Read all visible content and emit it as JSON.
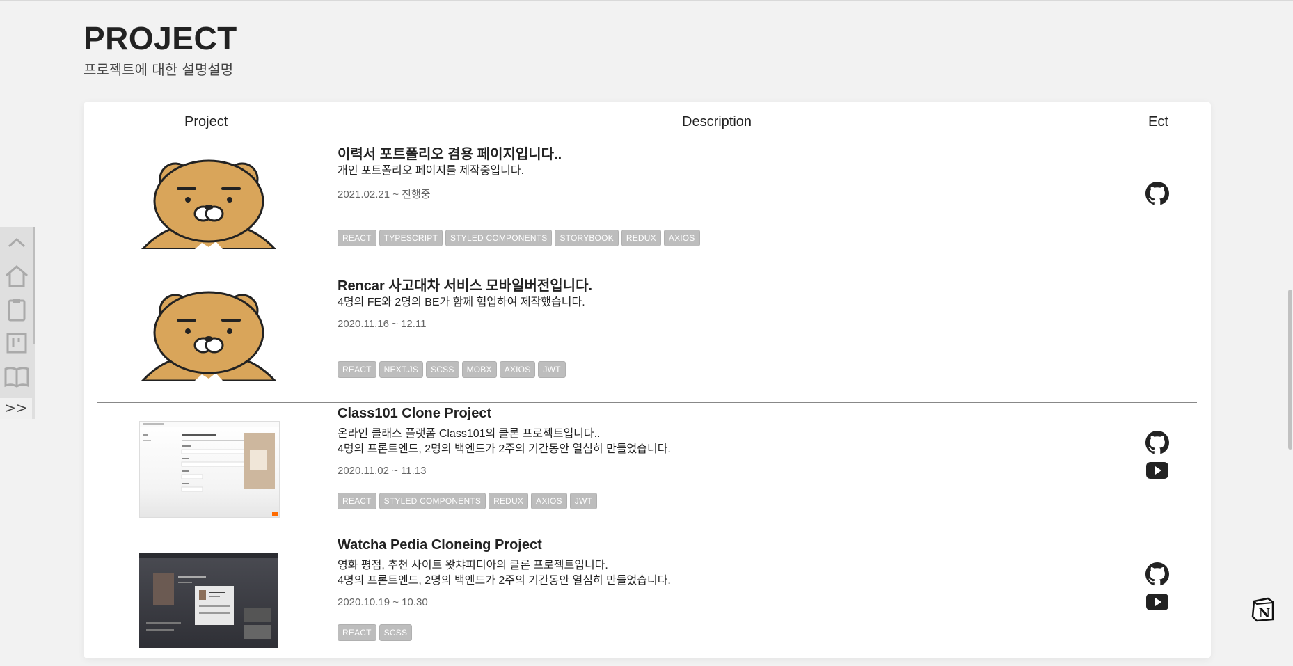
{
  "header": {
    "title": "PROJECT",
    "subtitle": "프로젝트에 대한 설명설명"
  },
  "table": {
    "columns": {
      "project": "Project",
      "description": "Description",
      "etc": "Ect"
    },
    "rows": [
      {
        "image": "ryan-character",
        "title": "이력서 포트폴리오 겸용 페이지입니다..",
        "desc_lines": [
          "개인 포트폴리오 페이지를 제작중입니다."
        ],
        "date": "2021.02.21 ~ 진행중",
        "tags": [
          "REACT",
          "TYPESCRIPT",
          "STYLED COMPONENTS",
          "STORYBOOK",
          "REDUX",
          "AXIOS"
        ],
        "links": [
          "github-icon"
        ]
      },
      {
        "image": "ryan-character",
        "title": "Rencar 사고대차 서비스 모바일버전입니다.",
        "desc_lines": [
          "4명의 FE와 2명의 BE가 함께 협업하여 제작했습니다."
        ],
        "date": "2020.11.16 ~ 12.11",
        "tags": [
          "REACT",
          "NEXT.JS",
          "SCSS",
          "MOBX",
          "AXIOS",
          "JWT"
        ],
        "links": []
      },
      {
        "image": "class101-screenshot",
        "title": "Class101 Clone Project",
        "desc_lines": [
          "온라인 클래스 플랫폼 Class101의 클론 프로젝트입니다..",
          "4명의 프론트엔드, 2명의 백엔드가 2주의 기간동안 열심히 만들었습니다."
        ],
        "date": "2020.11.02 ~ 11.13",
        "tags": [
          "REACT",
          "STYLED COMPONENTS",
          "REDUX",
          "AXIOS",
          "JWT"
        ],
        "links": [
          "github-icon",
          "youtube-icon"
        ]
      },
      {
        "image": "watcha-screenshot",
        "title": "Watcha Pedia Cloneing Project",
        "desc_lines": [
          "영화 평점, 추천 사이트 왓챠피디아의 클론 프로젝트입니다.",
          "4명의 프론트엔드, 2명의 백엔드가 2주의 기간동안 열심히 만들었습니다."
        ],
        "date": "2020.10.19 ~ 10.30",
        "tags": [
          "REACT",
          "SCSS"
        ],
        "links": [
          "github-icon",
          "youtube-icon"
        ]
      }
    ]
  },
  "sidenav": {
    "items": [
      "chevron-up-icon",
      "home-icon",
      "clipboard-icon",
      "board-icon",
      "book-icon"
    ],
    "more": ">>"
  },
  "colors": {
    "background": "#f2f2f2",
    "tag": "#bdbdbd",
    "card": "#ffffff"
  }
}
